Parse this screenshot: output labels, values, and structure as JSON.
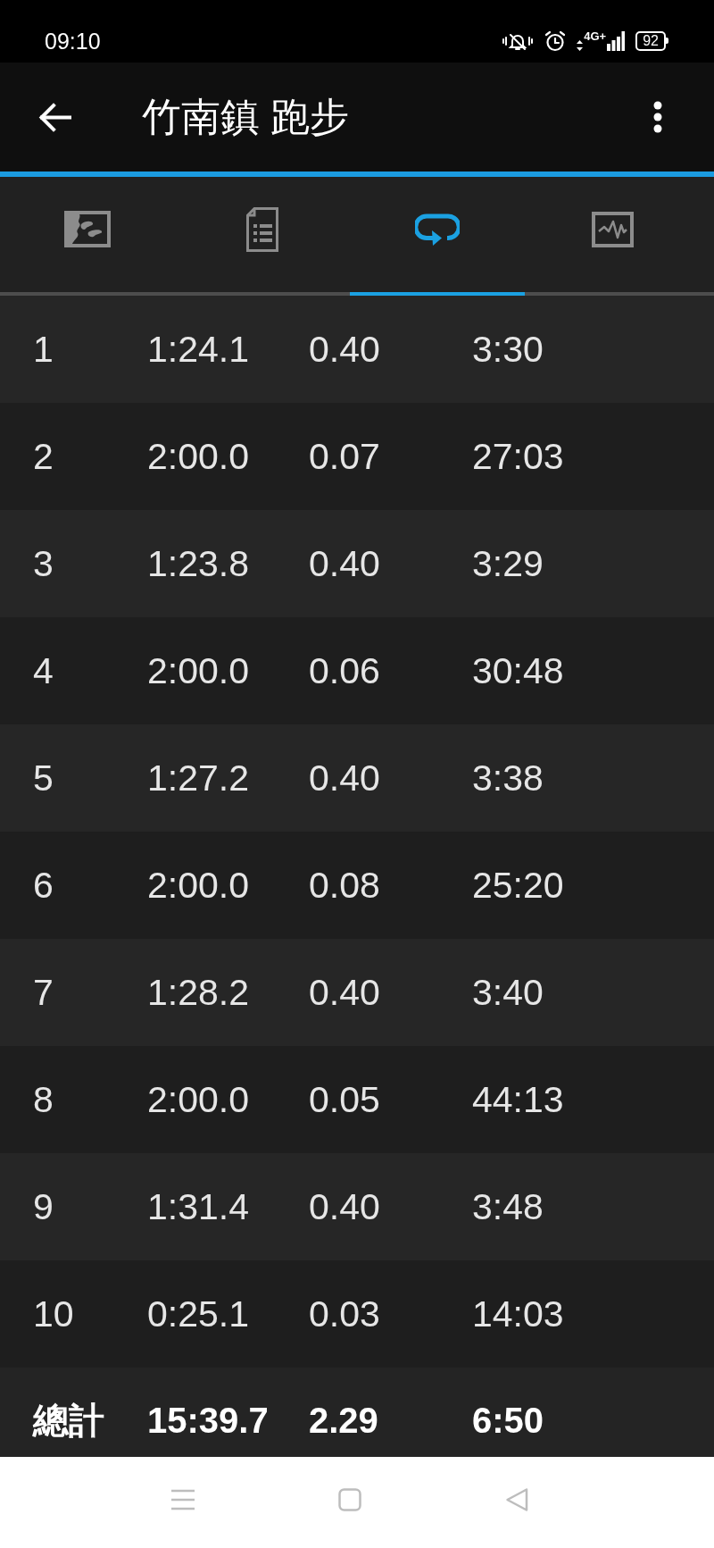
{
  "status_bar": {
    "time": "09:10",
    "network": "4G+",
    "battery": "92"
  },
  "app_bar": {
    "title": "竹南鎮 跑步"
  },
  "tabs": [
    {
      "kind": "map",
      "selected": false
    },
    {
      "kind": "details",
      "selected": false
    },
    {
      "kind": "laps",
      "selected": true
    },
    {
      "kind": "chart",
      "selected": false
    }
  ],
  "laps": [
    {
      "cells": [
        "1",
        "1:24.1",
        "0.40",
        "3:30"
      ]
    },
    {
      "cells": [
        "2",
        "2:00.0",
        "0.07",
        "27:03"
      ]
    },
    {
      "cells": [
        "3",
        "1:23.8",
        "0.40",
        "3:29"
      ]
    },
    {
      "cells": [
        "4",
        "2:00.0",
        "0.06",
        "30:48"
      ]
    },
    {
      "cells": [
        "5",
        "1:27.2",
        "0.40",
        "3:38"
      ]
    },
    {
      "cells": [
        "6",
        "2:00.0",
        "0.08",
        "25:20"
      ]
    },
    {
      "cells": [
        "7",
        "1:28.2",
        "0.40",
        "3:40"
      ]
    },
    {
      "cells": [
        "8",
        "2:00.0",
        "0.05",
        "44:13"
      ]
    },
    {
      "cells": [
        "9",
        "1:31.4",
        "0.40",
        "3:48"
      ]
    },
    {
      "cells": [
        "10",
        "0:25.1",
        "0.03",
        "14:03"
      ]
    }
  ],
  "total": {
    "cells": [
      "總計",
      "15:39.7",
      "2.29",
      "6:50"
    ]
  }
}
